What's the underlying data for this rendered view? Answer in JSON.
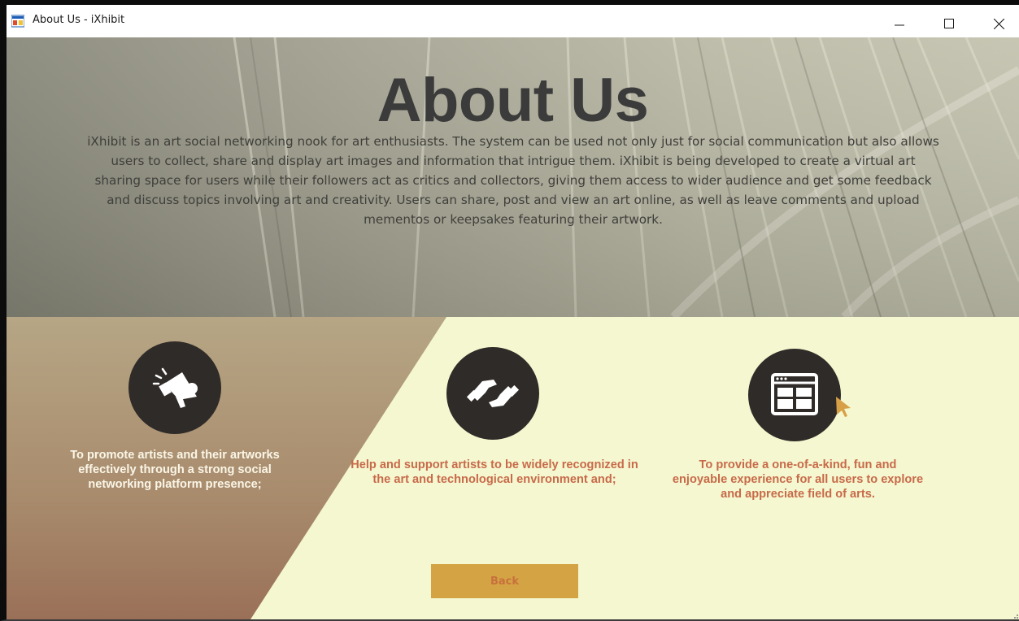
{
  "window": {
    "title": "About Us - iXhibit",
    "controls": [
      "minimize-icon",
      "maximize-icon",
      "close-icon"
    ],
    "app_icon": "window-app-icon"
  },
  "hero": {
    "heading": "About Us",
    "intro": "iXhibit is an art social networking nook for art enthusiasts. The system can be used not only just for social communication but also allows users to collect, share and display art images and information that intrigue them. iXhibit is being developed to create a virtual art sharing space for users while their followers act as critics and collectors, giving them access to wider audience and get some feedback and discuss topics involving art and creativity. Users can share, post and view an art online, as well as leave comments and upload mementos or keepsakes featuring their artwork."
  },
  "features": [
    {
      "icon": "megaphone-icon",
      "text": "To promote artists and their artworks effectively through a strong social networking platform presence;"
    },
    {
      "icon": "handshake-icon",
      "text": "Help and support artists to be widely recognized in the art and technological environment and;"
    },
    {
      "icon": "browser-window-icon",
      "text": "To provide a one-of-a-kind, fun and enjoyable experience for all users to explore and appreciate field of arts."
    }
  ],
  "actions": {
    "back_label": "Back"
  },
  "colors": {
    "hero_overlay": "#8f8d7c",
    "lower_background": "#f4f7cf",
    "left_gradient_top": "#b6a685",
    "left_gradient_bottom": "#9a7058",
    "icon_circle": "#2f2b28",
    "feature_text_light": "#fbf6e8",
    "feature_text_accent": "#c86a4a",
    "back_button": "#d4a444",
    "back_label": "#c8703c",
    "cursor_accent": "#d8a046"
  }
}
